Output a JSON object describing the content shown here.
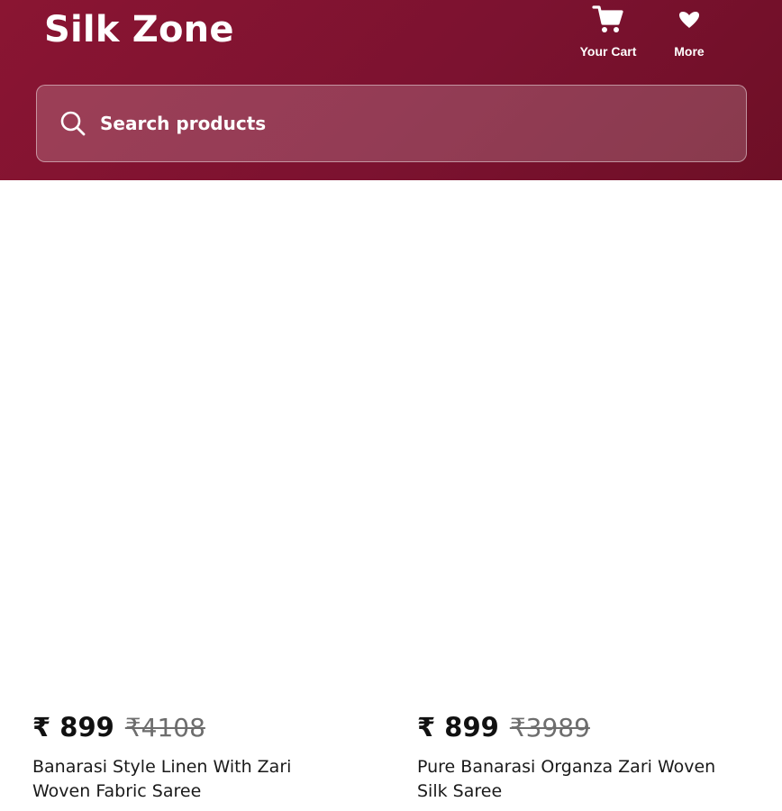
{
  "header": {
    "brand": "Silk Zone",
    "cart_label": "Your Cart",
    "more_label": "More",
    "cart_icon": "cart-icon",
    "more_icon": "chevron-down-icon"
  },
  "search": {
    "placeholder": "Search products",
    "icon": "search-icon"
  },
  "products": [
    {
      "price": "₹ 899",
      "mrp": "₹4108",
      "name": "Banarasi Style Linen With Zari Woven Fabric Saree"
    },
    {
      "price": "₹ 899",
      "mrp": "₹3989",
      "name": "Pure Banarasi Organza Zari Woven Silk Saree"
    }
  ],
  "colors": {
    "header_bg": "#7c1230",
    "text_primary": "#111111",
    "text_strike": "#6d6d6d"
  }
}
